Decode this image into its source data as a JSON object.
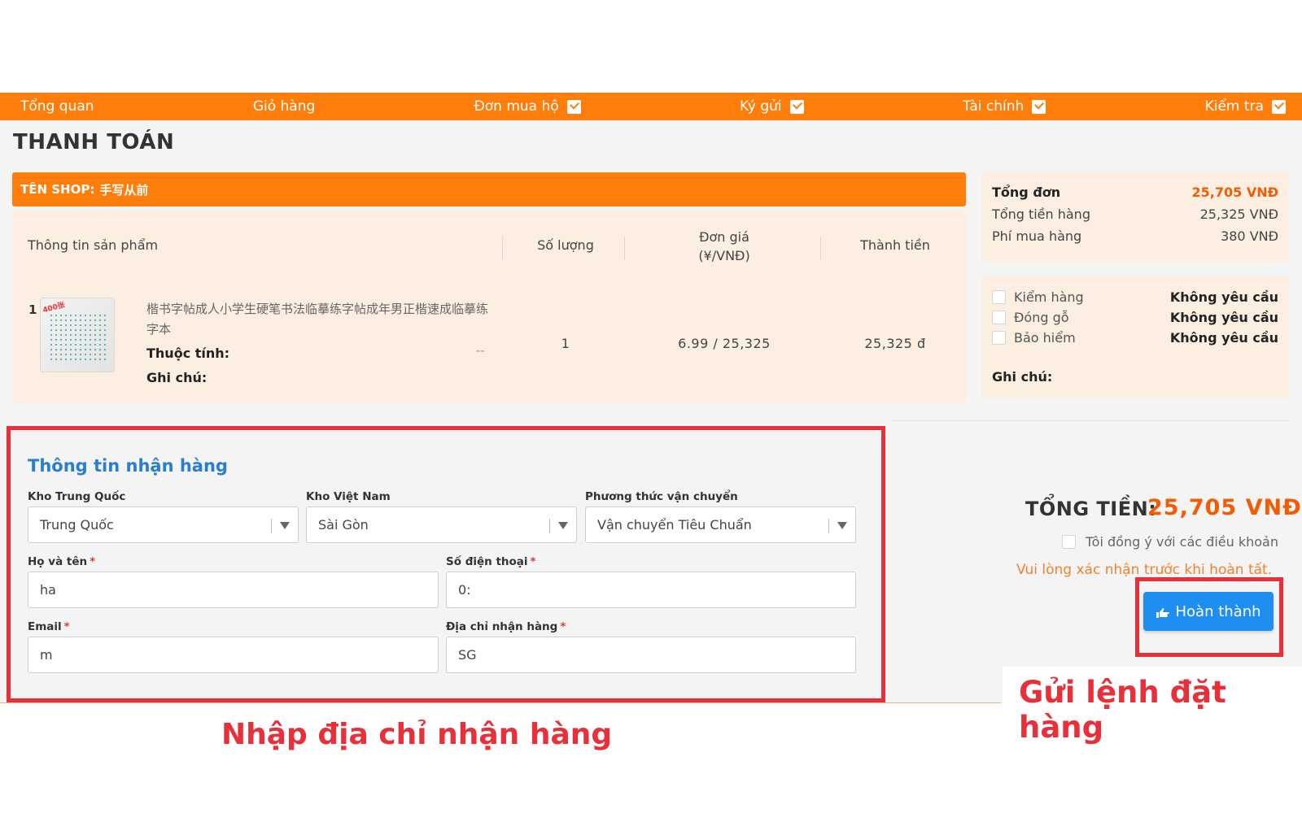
{
  "nav": {
    "items": [
      {
        "label": "Tổng quan",
        "has_dropdown": false
      },
      {
        "label": "Giỏ hàng",
        "has_dropdown": false
      },
      {
        "label": "Đơn mua hộ",
        "has_dropdown": true
      },
      {
        "label": "Ký gửi",
        "has_dropdown": true
      },
      {
        "label": "Tài chính",
        "has_dropdown": true
      },
      {
        "label": "Kiểm tra",
        "has_dropdown": true
      }
    ]
  },
  "page": {
    "title": "THANH TOÁN"
  },
  "shop": {
    "label": "TÊN SHOP:",
    "name": "手写从前"
  },
  "table": {
    "headers": {
      "product": "Thông tin sản phẩm",
      "quantity": "Số lượng",
      "unit_price_l1": "Đơn giá",
      "unit_price_l2": "(¥/VNĐ)",
      "total": "Thành tiền"
    },
    "row": {
      "index": "1",
      "name": "楷书字帖成人小学生硬笔书法临摹练字帖成年男正楷速成临摹练字本",
      "attr_label": "Thuộc tính:",
      "note_label": "Ghi chú:",
      "attr_value": "--",
      "quantity": "1",
      "unit_price": "6.99 / 25,325",
      "total": "25,325 đ",
      "thumb_badge": "400张"
    }
  },
  "summary": {
    "order_total_label": "Tổng đơn",
    "order_total": "25,705 VNĐ",
    "goods_total_label": "Tổng tiền hàng",
    "goods_total": "25,325 VNĐ",
    "fee_label": "Phí mua hàng",
    "fee": "380 VNĐ"
  },
  "options": {
    "items": [
      {
        "label": "Kiểm hàng",
        "value": "Không yêu cầu"
      },
      {
        "label": "Đóng gỗ",
        "value": "Không yêu cầu"
      },
      {
        "label": "Bảo hiểm",
        "value": "Không yêu cầu"
      }
    ],
    "note_label": "Ghi chú:"
  },
  "form": {
    "title": "Thông tin nhận hàng",
    "cn_warehouse_label": "Kho Trung Quốc",
    "cn_warehouse_value": "Trung Quốc",
    "vn_warehouse_label": "Kho Việt Nam",
    "vn_warehouse_value": "Sài Gòn",
    "shipping_label": "Phương thức vận chuyển",
    "shipping_value": "Vận chuyển Tiêu Chuẩn",
    "fullname_label": "Họ và tên",
    "fullname_value": "ha",
    "phone_label": "Số điện thoại",
    "phone_value": "0:",
    "email_label": "Email",
    "email_value": "m",
    "address_label": "Địa chỉ nhận hàng",
    "address_value": "SG",
    "required_mark": "*"
  },
  "checkout": {
    "total_label": "TỔNG TIỀN:",
    "total_value": "25,705 VNĐ",
    "agree_label": "Tôi đồng ý với các điều khoản",
    "warning": "Vui lòng xác nhận trước khi hoàn tất.",
    "submit_label": "Hoàn thành"
  },
  "annotations": {
    "left_caption": "Nhập địa chỉ nhận hàng",
    "right_caption": "Gửi lệnh đặt hàng"
  },
  "colors": {
    "accent": "#ff7d0a",
    "panel": "#fdeee2",
    "highlight": "#e8303a",
    "primary_button": "#1f8ef1",
    "price": "#f25c05"
  }
}
